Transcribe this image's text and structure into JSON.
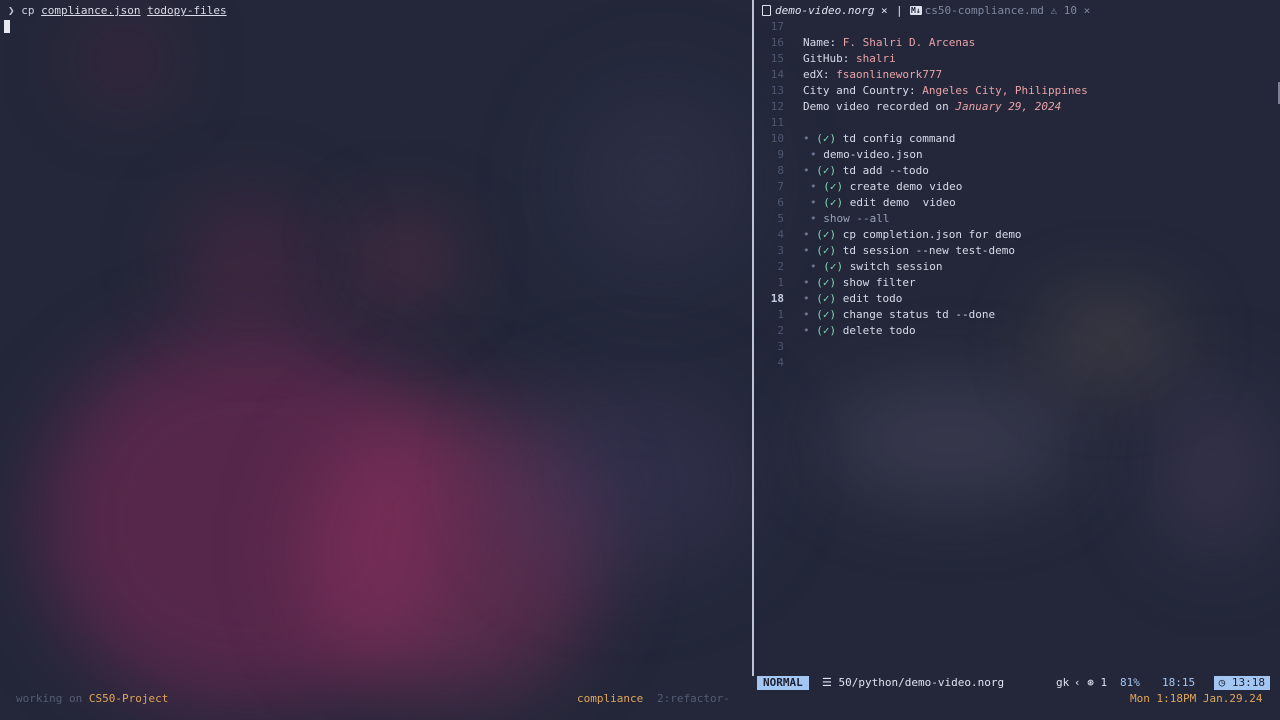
{
  "terminal": {
    "prompt_symbol": "❯",
    "command": "cp",
    "arg1": "compliance.json",
    "arg2": "todopy-files"
  },
  "editor": {
    "tabs": [
      {
        "label": "demo-video.norg",
        "close": "×"
      },
      {
        "label": "cs50-compliance.md",
        "warning": "⚠ 10",
        "close": "×"
      }
    ],
    "separator": "|",
    "lines": [
      {
        "num": "17"
      },
      {
        "num": "16",
        "key": "Name:",
        "value": "F. Shalri D. Arcenas"
      },
      {
        "num": "15",
        "key": "GitHub:",
        "value": "shalri"
      },
      {
        "num": "14",
        "key": "edX:",
        "value": "fsaonlinework777"
      },
      {
        "num": "13",
        "key": "City and Country:",
        "value": "Angeles City, Philippines"
      },
      {
        "num": "12",
        "key": "Demo video recorded on",
        "date": "January 29, 2024"
      },
      {
        "num": "11"
      },
      {
        "num": "10",
        "indent": 0,
        "check": true,
        "text": "td config command"
      },
      {
        "num": "9",
        "indent": 1,
        "check": false,
        "text": "demo-video.json"
      },
      {
        "num": "8",
        "indent": 0,
        "check": true,
        "text": "td add --todo"
      },
      {
        "num": "7",
        "indent": 1,
        "check": true,
        "text": "create demo video"
      },
      {
        "num": "6",
        "indent": 1,
        "check": true,
        "text": "edit demo  video"
      },
      {
        "num": "5",
        "indent": 1,
        "check": false,
        "text": "show --all",
        "dim": true
      },
      {
        "num": "4",
        "indent": 0,
        "check": true,
        "text": "cp completion.json for demo"
      },
      {
        "num": "3",
        "indent": 0,
        "check": true,
        "text": "td session --new test-demo"
      },
      {
        "num": "2",
        "indent": 1,
        "check": true,
        "text": "switch session"
      },
      {
        "num": "1",
        "indent": 0,
        "check": true,
        "text": "show filter"
      },
      {
        "num": "18",
        "indent": 0,
        "check": true,
        "text": "edit todo",
        "current": true
      },
      {
        "num": "1",
        "indent": 0,
        "check": true,
        "text": "change status td --done"
      },
      {
        "num": "2",
        "indent": 0,
        "check": true,
        "text": "delete todo"
      },
      {
        "num": "3"
      },
      {
        "num": "4"
      }
    ],
    "bullet": "•",
    "check_glyph": "(✓)"
  },
  "statusline": {
    "mode": "NORMAL",
    "filepath": "50/python/demo-video.norg",
    "gk": "gk",
    "branch_count": "1",
    "percent": "81%",
    "position": "18:15",
    "clock": "13:18"
  },
  "tmux": {
    "left_prefix": "working on",
    "project": "CS50-Project",
    "window1": "compliance",
    "window2": "2:refactor-",
    "datetime": "Mon 1:18PM Jan.29.24"
  },
  "colors": {
    "accent": "#a4c6f2",
    "check": "#7fd6b1",
    "value": "#e8a2a8",
    "tmux_accent": "#e0a65a"
  }
}
